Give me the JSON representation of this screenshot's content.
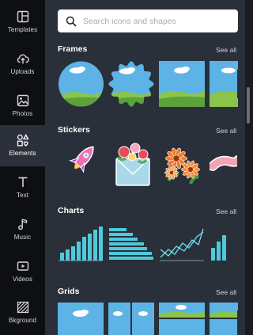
{
  "sidebar": {
    "items": [
      {
        "label": "Templates",
        "icon": "templates-icon"
      },
      {
        "label": "Uploads",
        "icon": "cloud-upload-icon"
      },
      {
        "label": "Photos",
        "icon": "image-icon"
      },
      {
        "label": "Elements",
        "icon": "shapes-icon",
        "active": true
      },
      {
        "label": "Text",
        "icon": "text-icon"
      },
      {
        "label": "Music",
        "icon": "music-note-icon"
      },
      {
        "label": "Videos",
        "icon": "video-icon"
      },
      {
        "label": "Bkground",
        "icon": "background-pattern-icon"
      }
    ]
  },
  "search": {
    "placeholder": "Search icons and shapes"
  },
  "sections": [
    {
      "title": "Frames",
      "see_all": "See all"
    },
    {
      "title": "Stickers",
      "see_all": "See all"
    },
    {
      "title": "Charts",
      "see_all": "See all"
    },
    {
      "title": "Grids",
      "see_all": "See all"
    }
  ],
  "colors": {
    "sidebar_bg": "#0e0f12",
    "panel_bg": "#293039",
    "active_item": "#2c303a",
    "sky": "#5eb3e6",
    "grass": "#8ac44b",
    "chart_accent": "#4fc9dc"
  }
}
